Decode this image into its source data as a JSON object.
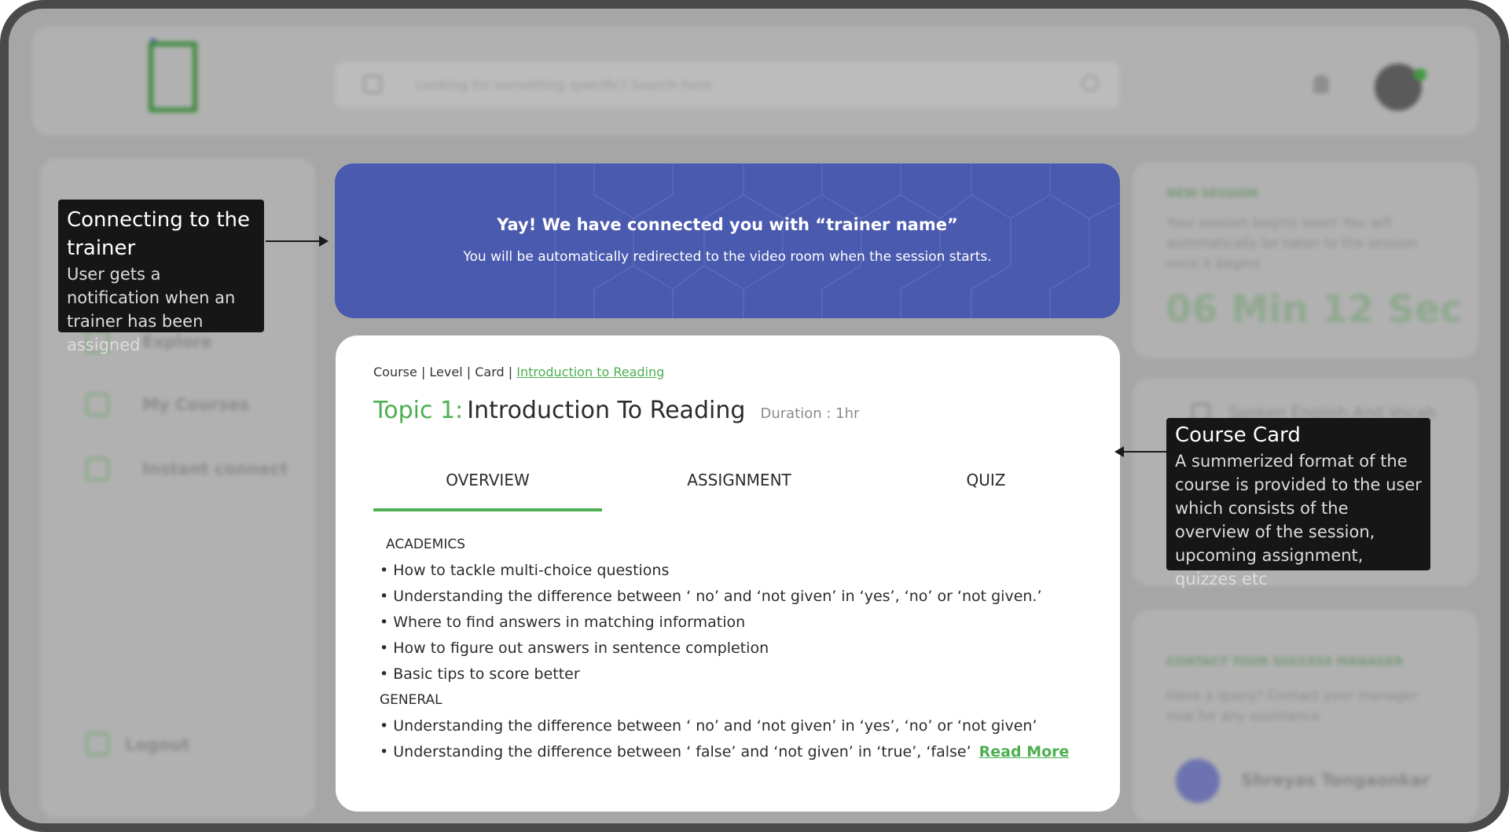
{
  "header": {
    "search_placeholder": "Looking for something specific? Search here"
  },
  "sidebar": {
    "items": [
      {
        "label": "Explore",
        "icon": "compass-icon"
      },
      {
        "label": "My Courses",
        "icon": "book-icon"
      },
      {
        "label": "Instant connect",
        "icon": "connect-icon"
      }
    ],
    "logout_label": "Logout"
  },
  "session": {
    "tag": "NEW SESSION",
    "text": "Your session begins soon! You will automatically be taken to the session once it begins",
    "timer": "06 Min 12 Sec"
  },
  "course_widget": {
    "title": "Spoken English And Vocab"
  },
  "manager": {
    "tag": "CONTACT YOUR SUCCESS MANAGER",
    "text": "Have a query? Contact your manager now for any assistance",
    "name": "Shreyas Tongaonkar"
  },
  "banner": {
    "title": "Yay! We have connected you with “trainer name”",
    "subtitle": "You will be automatically redirected to the video room when the session starts."
  },
  "card": {
    "breadcrumb": [
      "Course",
      "Level",
      "Card"
    ],
    "breadcrumb_link": "Introduction to Reading",
    "topic_label": "Topic 1:",
    "topic_name": "Introduction To Reading",
    "duration": "Duration : 1hr",
    "tabs": [
      "OVERVIEW",
      "ASSIGNMENT",
      "QUIZ"
    ],
    "active_tab": "OVERVIEW",
    "sections": [
      {
        "heading": "ACADEMICS",
        "bullets": [
          "• How to tackle multi-choice questions",
          "• Understanding the difference between ‘ no’ and ‘not given’ in ‘yes’, ‘no’ or ‘not given.’",
          "• Where to find answers in matching information",
          "• How to figure out answers in sentence completion",
          "• Basic tips to score better"
        ]
      },
      {
        "heading": "GENERAL",
        "bullets": [
          "• Understanding the difference between ‘ no’ and ‘not given’ in ‘yes’, ‘no’ or ‘not given’",
          "• Understanding the difference between ‘ false’ and ‘not given’ in ‘true’, ‘false’"
        ]
      }
    ],
    "read_more": "Read More"
  },
  "annotations": {
    "left": {
      "title": "Connecting to the trainer",
      "body": "User gets a notification when an trainer has been assigned"
    },
    "right": {
      "title": "Course Card",
      "body": "A summerized format of the course is provided to the user which consists of the overview of the session, upcoming assignment, quizzes etc"
    }
  },
  "colors": {
    "accent_green": "#4caf50",
    "banner_blue": "#4a5aae",
    "overlay_gray": "#a6a6a6",
    "annotation_bg": "#161616"
  }
}
